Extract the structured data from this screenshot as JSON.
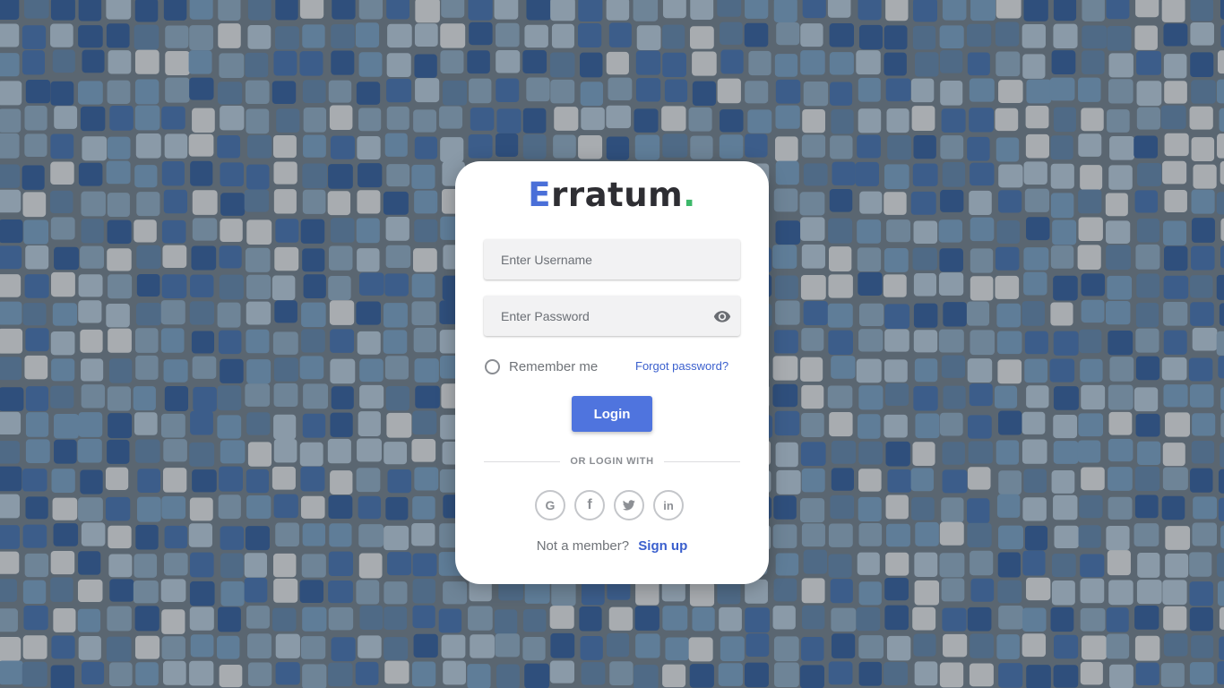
{
  "app": {
    "logo_first_letter": "E",
    "logo_rest": "rratum",
    "logo_dot": ".",
    "logo_dot_color": "#3db86a",
    "logo_accent_color": "#4a6fd8"
  },
  "form": {
    "username_placeholder": "Enter Username",
    "username_value": "",
    "password_placeholder": "Enter Password",
    "password_value": "",
    "remember_label": "Remember me",
    "remember_checked": false,
    "forgot_label": "Forgot password?",
    "login_label": "Login",
    "login_color": "#4f74de"
  },
  "social": {
    "divider_label": "OR LOGIN WITH",
    "providers": [
      {
        "name": "google",
        "glyph": "G",
        "icon": "google-icon"
      },
      {
        "name": "facebook",
        "glyph": "f",
        "icon": "facebook-icon"
      },
      {
        "name": "twitter",
        "glyph": "",
        "icon": "twitter-icon"
      },
      {
        "name": "linkedin",
        "glyph": "in",
        "icon": "linkedin-icon"
      }
    ]
  },
  "signup": {
    "prompt": "Not a member?",
    "link_label": "Sign up"
  },
  "background": {
    "description_icon": "mosaic-tile-pattern",
    "tile_colors": [
      "#8a9aa8",
      "#6e8497",
      "#4f6a86",
      "#2f4f7c",
      "#a8acb0",
      "#5f7d98",
      "#3c5d8a"
    ]
  }
}
